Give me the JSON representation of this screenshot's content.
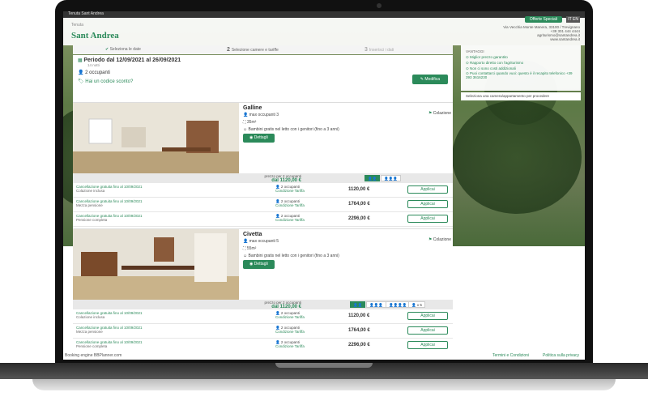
{
  "header": {
    "topline": "Tenuta Sant Andrea",
    "logo_small": "Tenuta",
    "logo_name": "Sant Andrea",
    "offer_button": "Offerte Speciali",
    "lang": "IT EN",
    "contact": [
      "Via Vecchia Monte Manera, 33100 / Trevignano",
      "+39 301 444 4444",
      "agriturismo@santandrea.it",
      "www.santandrea.it"
    ]
  },
  "steps": [
    "Seleziona le date",
    "Selezione camere e tariffe",
    "Inserisci i dati"
  ],
  "period": {
    "title": "Periodo dal 12/09/2021 al 26/09/2021",
    "nights": "14 notti",
    "guests": "2 occupanti",
    "promo": "Hai un codice sconto?",
    "edit": "Modifica"
  },
  "rooms": [
    {
      "name": "Galline",
      "max": "max occupanti 3",
      "size": "35m²",
      "kids": "Bambini gratis nel letto con i genitori (fino a 3 anni)",
      "details": "Dettagli",
      "breakfast": "Colazione",
      "price_from": "prezzo per 2 occupanti",
      "price_value": "dal 1120,00 €",
      "occupancy": [
        "👤👤",
        "👤👤👤"
      ],
      "rates": [
        {
          "note": "Cancellazione gratuita fino al 10/09/2021",
          "type": "Colazione inclusa",
          "occ": "👤 2 occupanti",
          "cond": "Condizione Tariffa",
          "price": "1120,00 €",
          "btn": "Applicai"
        },
        {
          "note": "Cancellazione gratuita fino al 10/09/2021",
          "type": "Mezza pensione",
          "occ": "👤 2 occupanti",
          "cond": "Condizione Tariffa",
          "price": "1764,00 €",
          "btn": "Applicai"
        },
        {
          "note": "Cancellazione gratuita fino al 10/09/2021",
          "type": "Pensione completa",
          "occ": "👤 2 occupanti",
          "cond": "Condizione Tariffa",
          "price": "2296,00 €",
          "btn": "Applicai"
        }
      ]
    },
    {
      "name": "Civetta",
      "max": "max occupanti 5",
      "size": "55m²",
      "kids": "Bambini gratis nel letto con i genitori (fino a 3 anni)",
      "details": "Dettagli",
      "breakfast": "Colazione",
      "price_from": "prezzo per 2 occupanti",
      "price_value": "dal 1120,00 €",
      "occupancy": [
        "👤👤",
        "👤👤👤",
        "👤👤👤👤",
        "👤 x 5"
      ],
      "rates": [
        {
          "note": "Cancellazione gratuita fino al 10/09/2021",
          "type": "Colazione inclusa",
          "occ": "👤 2 occupanti",
          "cond": "Condizione Tariffa",
          "price": "1120,00 €",
          "btn": "Applicai"
        },
        {
          "note": "Cancellazione gratuita fino al 10/09/2021",
          "type": "Mezza pensione",
          "occ": "👤 2 occupanti",
          "cond": "Condizione Tariffa",
          "price": "1764,00 €",
          "btn": "Applicai"
        },
        {
          "note": "Cancellazione gratuita fino al 10/09/2021",
          "type": "Pensione completa",
          "occ": "👤 2 occupanti",
          "cond": "Condizione Tariffa",
          "price": "2296,00 €",
          "btn": "Applicai"
        }
      ]
    }
  ],
  "sidebar": {
    "title": "VANTAGGI",
    "items": [
      "Miglior prezzo garantito",
      "Rapporto diretto con l'agriturismo",
      "Non ci sono costi addizionali",
      "Puoi contattarci quando vuoi: questo è il recapito telefonico +39 393 3616230"
    ],
    "select_hint": "Seleziona una camera/appartamento per procedere"
  },
  "footer": {
    "left": "Booking engine BBPlanner.com",
    "terms": "Termini e Condizioni",
    "privacy": "Politica sulla privacy"
  },
  "colors": {
    "accent": "#2b8a5a"
  }
}
